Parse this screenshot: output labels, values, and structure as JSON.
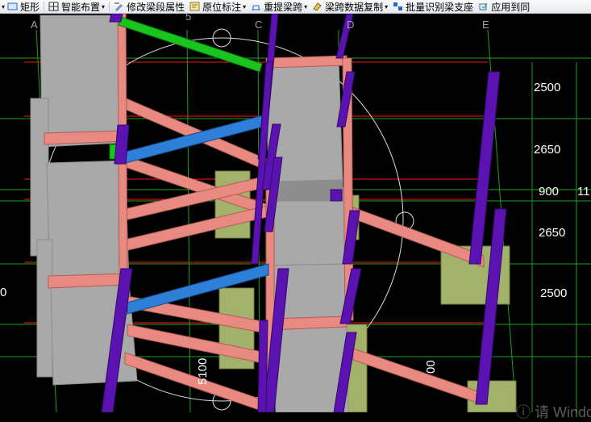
{
  "toolbar": {
    "items": [
      {
        "label": "矩形",
        "icon": "rectangle-icon",
        "dropdown": false
      },
      {
        "label": "智能布置",
        "icon": "grid-layout-icon",
        "dropdown": true
      },
      {
        "label": "修改梁段属性",
        "icon": "edit-property-icon",
        "dropdown": false
      },
      {
        "label": "原位标注",
        "icon": "annotate-icon",
        "dropdown": true
      },
      {
        "label": "重提梁跨",
        "icon": "span-icon",
        "dropdown": true
      },
      {
        "label": "梁跨数据复制",
        "icon": "copy-icon",
        "dropdown": true
      },
      {
        "label": "批量识别梁支座",
        "icon": "batch-icon",
        "dropdown": false
      },
      {
        "label": "应用到同",
        "icon": "apply-icon",
        "dropdown": false
      }
    ]
  },
  "axes": {
    "top": [
      "A",
      "5",
      "C",
      "D",
      "E"
    ],
    "right_dims": [
      "2500",
      "2650",
      "900",
      "2650",
      "2500"
    ],
    "right_cut": "11",
    "left_cut": "0",
    "bottom_dims": [
      "5100",
      "00"
    ]
  },
  "colors": {
    "beam": "#e88a82",
    "column": "#5a12b0",
    "slab": "#a9a9a9",
    "foundation": "#a3b26a",
    "blue_beam": "#2e7fd8",
    "green_beam": "#19c41c",
    "grid_green": "#19a319",
    "grid_red": "#ff1010"
  },
  "watermark": "ⓘ 请 Windows"
}
